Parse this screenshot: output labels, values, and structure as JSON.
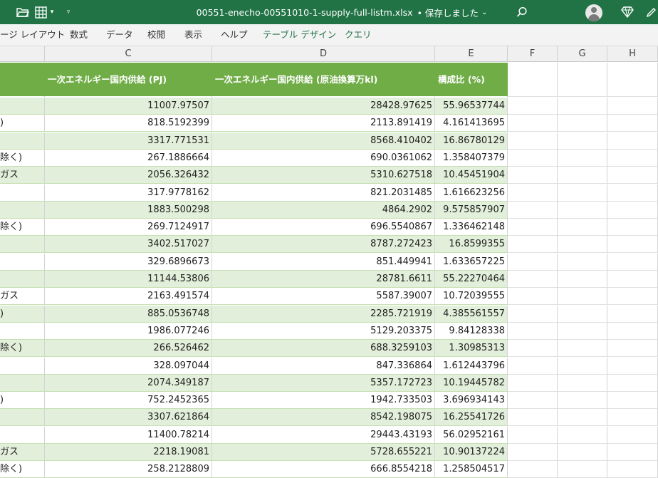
{
  "titlebar": {
    "filename": "00551-enecho-00551010-1-supply-full-listm.xlsx",
    "status": "• 保存しました",
    "icons": [
      "folder-open-icon",
      "table-icon",
      "chevron-down-icon",
      "customize-qat-icon",
      "search-icon",
      "account-icon",
      "premium-diamond-icon",
      "pen-icon"
    ]
  },
  "ribbon": {
    "tabs": [
      "ージ レイアウト",
      "数式",
      "データ",
      "校閲",
      "表示",
      "ヘルプ",
      "テーブル デザイン",
      "クエリ"
    ]
  },
  "colors": {
    "accent": "#217346",
    "table_header": "#70ad47",
    "band": "#e2efda",
    "band_border": "#c6e0b4"
  },
  "columns": [
    "C",
    "D",
    "E",
    "F",
    "G",
    "H"
  ],
  "table": {
    "headers": [
      "",
      "一次エネルギー国内供給 (PJ)",
      "一次エネルギー国内供給 (原油換算万kl)",
      "構成比 (%)"
    ],
    "rows": [
      [
        "",
        "11007.97507",
        "28428.97625",
        "55.96537744"
      ],
      [
        ")",
        "818.5192399",
        "2113.891419",
        "4.161413695"
      ],
      [
        "",
        "3317.771531",
        "8568.410402",
        "16.86780129"
      ],
      [
        "除く)",
        "267.1886664",
        "690.0361062",
        "1.358407379"
      ],
      [
        "ガス",
        "2056.326432",
        "5310.627518",
        "10.45451904"
      ],
      [
        "",
        "317.9778162",
        "821.2031485",
        "1.616623256"
      ],
      [
        "",
        "1883.500298",
        "4864.2902",
        "9.575857907"
      ],
      [
        "除く)",
        "269.7124917",
        "696.5540867",
        "1.336462148"
      ],
      [
        "",
        "3402.517027",
        "8787.272423",
        "16.8599355"
      ],
      [
        "",
        "329.6896673",
        "851.449941",
        "1.633657225"
      ],
      [
        "",
        "11144.53806",
        "28781.6611",
        "55.22270464"
      ],
      [
        "ガス",
        "2163.491574",
        "5587.39007",
        "10.72039555"
      ],
      [
        ")",
        "885.0536748",
        "2285.721919",
        "4.385561557"
      ],
      [
        "",
        "1986.077246",
        "5129.203375",
        "9.84128338"
      ],
      [
        "除く)",
        "266.526462",
        "688.3259103",
        "1.30985313"
      ],
      [
        "",
        "328.097044",
        "847.336864",
        "1.612443796"
      ],
      [
        "",
        "2074.349187",
        "5357.172723",
        "10.19445782"
      ],
      [
        ")",
        "752.2452365",
        "1942.733503",
        "3.696934143"
      ],
      [
        "",
        "3307.621864",
        "8542.198075",
        "16.25541726"
      ],
      [
        "",
        "11400.78214",
        "29443.43193",
        "56.02952161"
      ],
      [
        "ガス",
        "2218.19081",
        "5728.655221",
        "10.90137224"
      ],
      [
        "除く)",
        "258.2128809",
        "666.8554218",
        "1.258504517"
      ]
    ]
  }
}
